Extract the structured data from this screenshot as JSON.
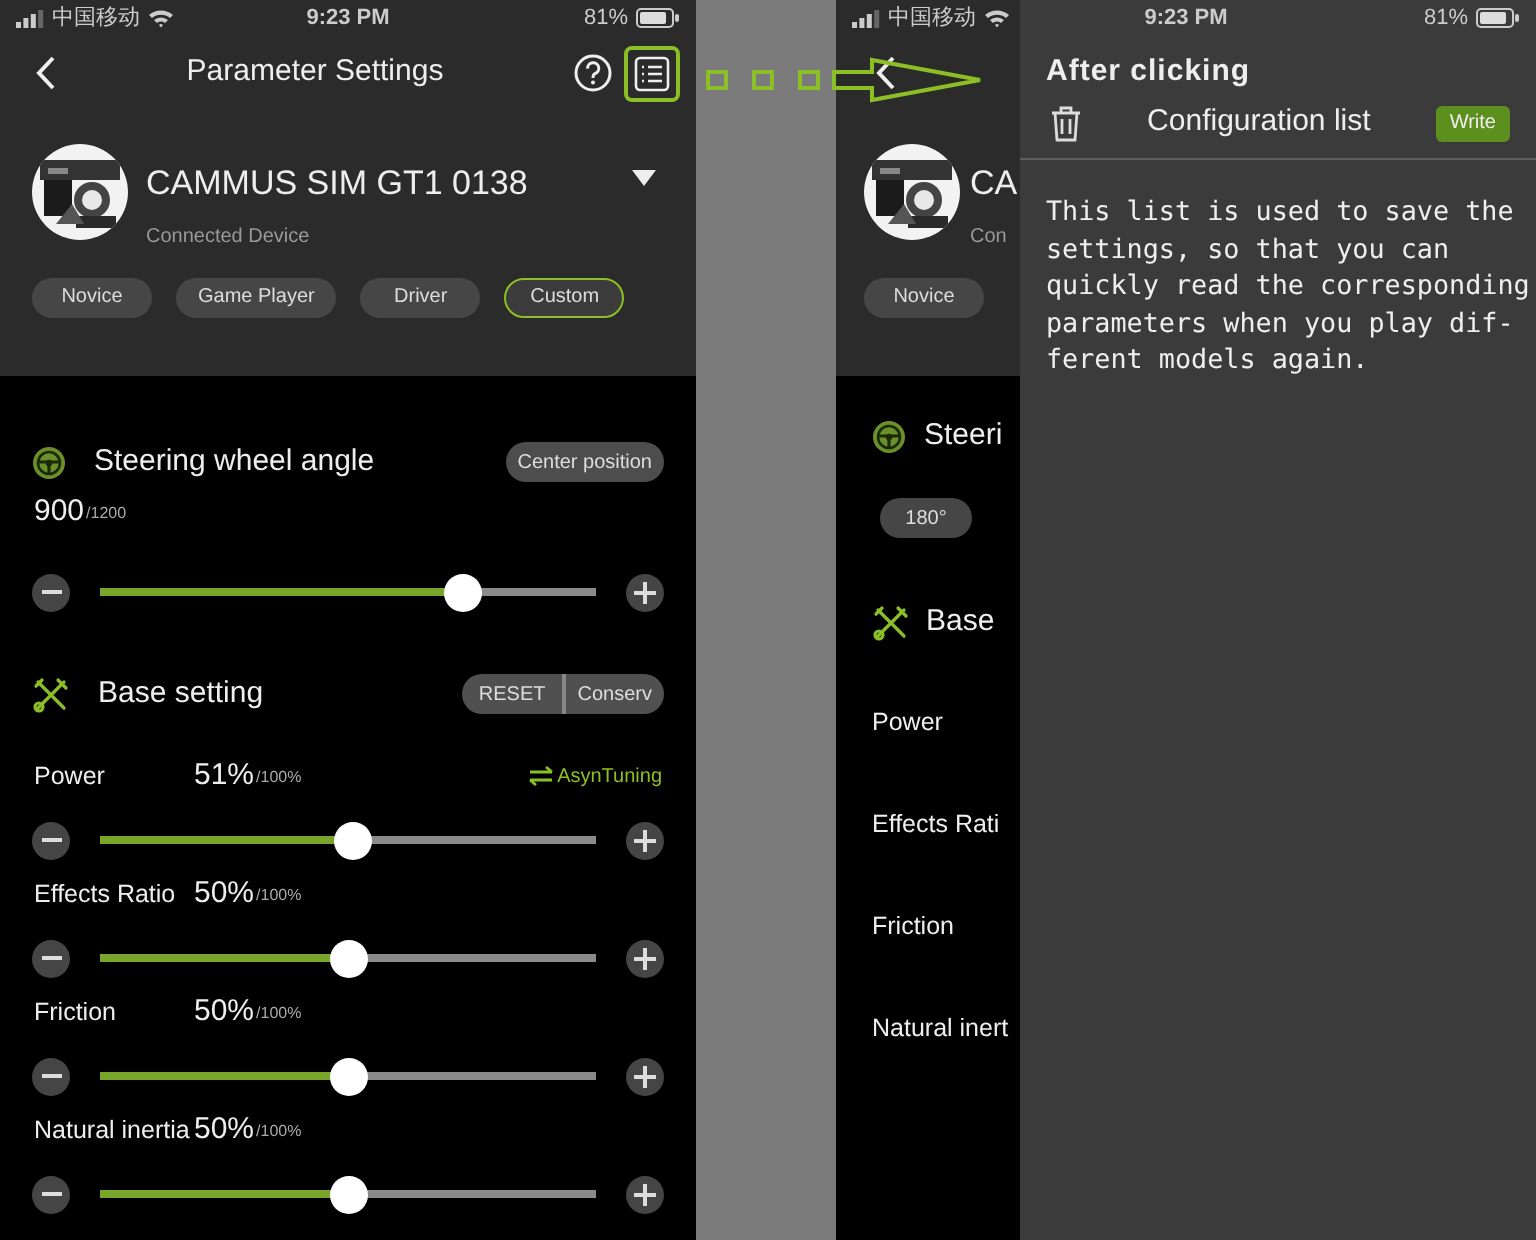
{
  "left_screen": {
    "status_bar": {
      "carrier": "中国移动",
      "time": "9:23 PM",
      "battery": "81%"
    },
    "nav": {
      "title": "Parameter Settings",
      "list_button_highlighted": true
    },
    "device": {
      "name": "CAMMUS SIM GT1 0138",
      "subtitle": "Connected Device"
    },
    "modes": [
      {
        "label": "Novice",
        "selected": false
      },
      {
        "label": "Game Player",
        "selected": false
      },
      {
        "label": "Driver",
        "selected": false
      },
      {
        "label": "Custom",
        "selected": true
      }
    ],
    "steering": {
      "title": "Steering wheel angle",
      "button": "Center position",
      "value": "900",
      "max": "/1200",
      "level": 0.73
    },
    "base": {
      "title": "Base setting",
      "buttons": [
        "RESET",
        "Conserv"
      ],
      "tuning": "AsynTuning",
      "params": [
        {
          "label": "Power",
          "value": "51%",
          "max": "/100%",
          "level": 0.51
        },
        {
          "label": "Effects Ratio",
          "value": "50%",
          "max": "/100%",
          "level": 0.5
        },
        {
          "label": "Friction",
          "value": "50%",
          "max": "/100%",
          "level": 0.5
        },
        {
          "label": "Natural inertia",
          "value": "50%",
          "max": "/100%",
          "level": 0.5
        }
      ]
    }
  },
  "right_screen": {
    "status_bar": {
      "carrier": "中国移动",
      "time": "9:23 PM",
      "battery": "81%"
    },
    "behind": {
      "device_name": "CA",
      "device_subtitle": "Con",
      "mode": "Novice",
      "steering_title": "Steeri",
      "angle_chip": "180°",
      "base_title": "Base",
      "params": [
        "Power",
        "Effects Rati",
        "Friction",
        "Natural inert"
      ]
    },
    "panel": {
      "title": "After clicking",
      "list_title": "Configuration list",
      "write_button": "Write",
      "description": "This list is used to save the settings, so that you can quickly read the corresponding parameters when you play dif-ferent models again."
    }
  }
}
